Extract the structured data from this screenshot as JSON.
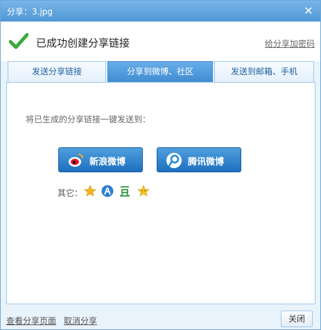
{
  "window": {
    "title": "分享：3.jpg",
    "close_glyph": "✕"
  },
  "header": {
    "success_text": "已成功创建分享链接",
    "set_password_link": "给分享加密码"
  },
  "tabs": [
    {
      "label": "发送分享链接",
      "active": false
    },
    {
      "label": "分享到微博、社区",
      "active": true
    },
    {
      "label": "发送到邮箱、手机",
      "active": false
    }
  ],
  "panel": {
    "hint": "将已生成的分享链接一键发送到：",
    "buttons": {
      "weibo": {
        "label": "新浪微博",
        "icon": "sina-weibo-icon"
      },
      "tencent": {
        "label": "腾讯微博",
        "icon": "tencent-weibo-icon"
      }
    },
    "others_label": "其它：",
    "other_icons": [
      "star-icon",
      "renren-icon",
      "douban-icon",
      "kaixin-icon"
    ]
  },
  "footer": {
    "view_link": "查看分享页面",
    "cancel_link": "取消分享",
    "close_button": "关闭"
  },
  "colors": {
    "titlebar": "#4f97d4",
    "active_tab": "#3f8ad0",
    "button_blue": "#1e6fbf",
    "check_green": "#3aa83a"
  }
}
